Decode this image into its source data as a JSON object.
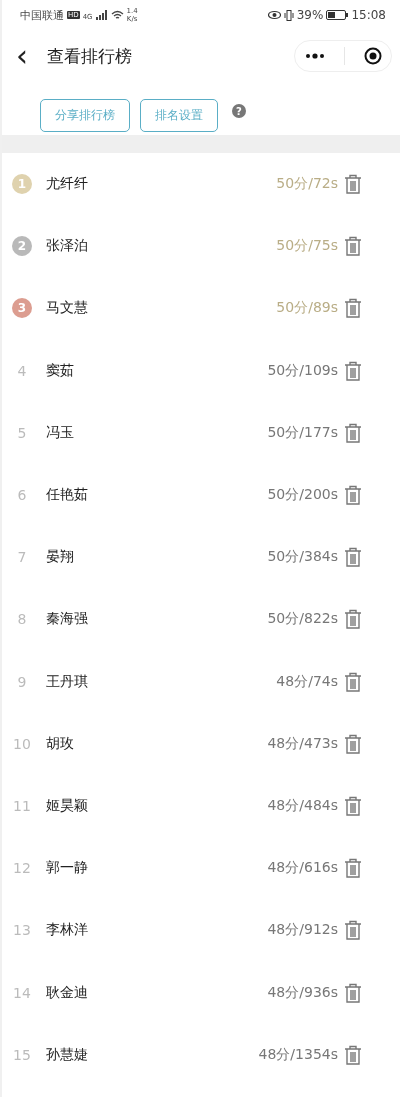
{
  "status_bar": {
    "carrier": "中国联通",
    "hd": "HD",
    "network": "4G",
    "speed": "1.4\nK/s",
    "battery": "39%",
    "time": "15:08"
  },
  "header": {
    "back": "‹",
    "title": "查看排行榜"
  },
  "actions": [
    {
      "label": "分享排行榜"
    },
    {
      "label": "排名设置"
    }
  ],
  "help": "?",
  "ranking": [
    {
      "rank": "1",
      "kind": "medal",
      "color": "#dfd2ae",
      "name": "尤纤纤",
      "score": "50分/72s"
    },
    {
      "rank": "2",
      "kind": "medal",
      "color": "#b9b9b9",
      "name": "张泽泊",
      "score": "50分/75s"
    },
    {
      "rank": "3",
      "kind": "medal",
      "color": "#dc9d90",
      "name": "马文慧",
      "score": "50分/89s"
    },
    {
      "rank": "4",
      "kind": "plain",
      "name": "窦茹",
      "score": "50分/109s"
    },
    {
      "rank": "5",
      "kind": "plain",
      "name": "冯玉",
      "score": "50分/177s"
    },
    {
      "rank": "6",
      "kind": "plain",
      "name": "任艳茹",
      "score": "50分/200s"
    },
    {
      "rank": "7",
      "kind": "plain",
      "name": "晏翔",
      "score": "50分/384s"
    },
    {
      "rank": "8",
      "kind": "plain",
      "name": "秦海强",
      "score": "50分/822s"
    },
    {
      "rank": "9",
      "kind": "plain",
      "name": "王丹琪",
      "score": "48分/74s"
    },
    {
      "rank": "10",
      "kind": "plain",
      "name": "胡玫",
      "score": "48分/473s"
    },
    {
      "rank": "11",
      "kind": "plain",
      "name": "姬昊颖",
      "score": "48分/484s"
    },
    {
      "rank": "12",
      "kind": "plain",
      "name": "郭一静",
      "score": "48分/616s"
    },
    {
      "rank": "13",
      "kind": "plain",
      "name": "李林洋",
      "score": "48分/912s"
    },
    {
      "rank": "14",
      "kind": "plain",
      "name": "耿金迪",
      "score": "48分/936s"
    },
    {
      "rank": "15",
      "kind": "plain",
      "name": "孙慧婕",
      "score": "48分/1354s"
    }
  ]
}
